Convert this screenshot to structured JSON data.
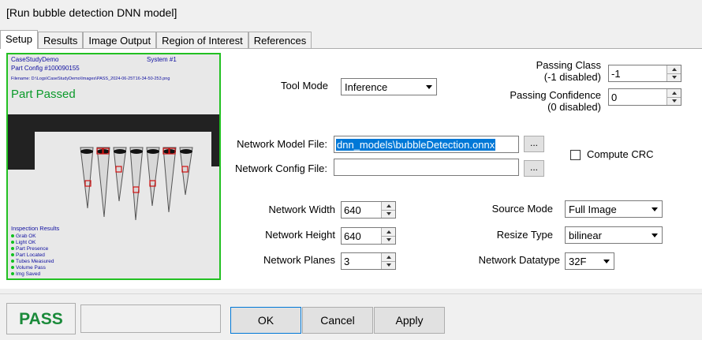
{
  "window": {
    "title": "[Run bubble detection DNN model]"
  },
  "tabs": [
    {
      "label": "Setup",
      "active": true
    },
    {
      "label": "Results"
    },
    {
      "label": "Image Output"
    },
    {
      "label": "Region of Interest"
    },
    {
      "label": "References"
    }
  ],
  "preview": {
    "app_name": "CaseStudyDemo",
    "system": "System #1",
    "part_config": "Part Config #100090155",
    "filename": "Filename: D:\\Logs\\CaseStudyDemo\\Images\\PASS_2024-06-25T16-34-50-253.png",
    "status": "Part Passed",
    "results_title": "Inspection Results",
    "results": [
      "Grab OK",
      "Light OK",
      "Part Presence",
      "Part Located",
      "Tubes Measured",
      "Volume Pass",
      "Img Saved"
    ]
  },
  "form": {
    "tool_mode_label": "Tool Mode",
    "tool_mode_value": "Inference",
    "passing_class_label_1": "Passing Class",
    "passing_class_label_2": "(-1 disabled)",
    "passing_class_value": "-1",
    "passing_conf_label_1": "Passing Confidence",
    "passing_conf_label_2": "(0 disabled)",
    "passing_conf_value": "0",
    "model_file_label": "Network Model File:",
    "model_file_value": "dnn_models\\bubbleDetection.onnx",
    "config_file_label": "Network Config File:",
    "config_file_value": "",
    "browse_label": "...",
    "compute_crc_label": "Compute CRC",
    "compute_crc_checked": false,
    "width_label": "Network Width",
    "width_value": "640",
    "height_label": "Network Height",
    "height_value": "640",
    "planes_label": "Network Planes",
    "planes_value": "3",
    "source_mode_label": "Source Mode",
    "source_mode_value": "Full Image",
    "resize_type_label": "Resize Type",
    "resize_type_value": "bilinear",
    "datatype_label": "Network Datatype",
    "datatype_value": "32F"
  },
  "footer": {
    "status": "PASS",
    "status_color": "#1a8a3a",
    "ok_label": "OK",
    "cancel_label": "Cancel",
    "apply_label": "Apply"
  }
}
